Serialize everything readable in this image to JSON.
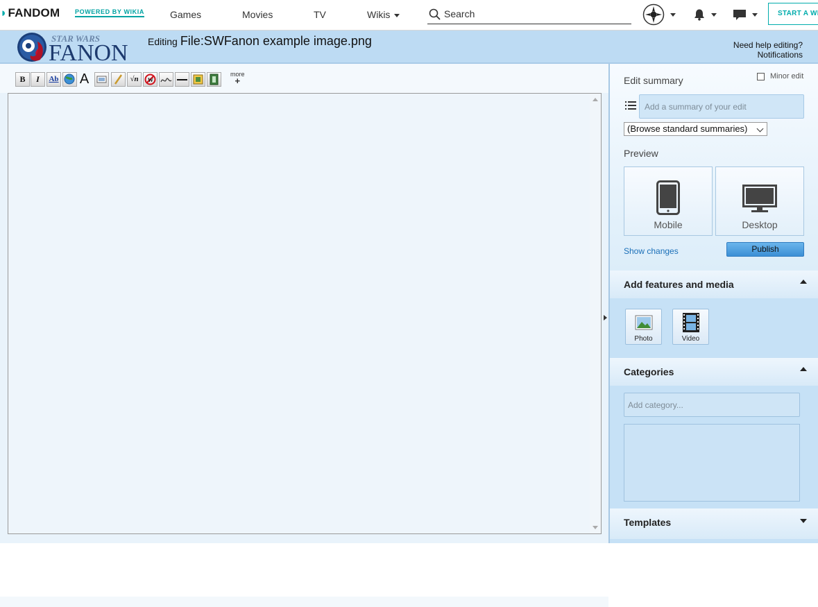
{
  "topnav": {
    "brand": "FANDOM",
    "powered_by": "POWERED BY WIKIA",
    "links": [
      "Games",
      "Movies",
      "TV",
      "Wikis"
    ],
    "search_placeholder": "Search",
    "start_wiki": "START A WIKI",
    "icons": [
      "user-avatar-icon",
      "notifications-bell-icon",
      "messages-icon"
    ]
  },
  "wiki_header": {
    "logo_text_small": "STAR WARS",
    "logo_text_big": "FANON",
    "editing_prefix": "Editing",
    "page_title": "File:SWFanon example image.png",
    "help_line1": "Need help editing?",
    "help_line2": "Notifications"
  },
  "toolbar": {
    "buttons": [
      "bold",
      "italic",
      "internal-link",
      "external-link",
      "heading",
      "embedded-file",
      "media-link",
      "math",
      "nowiki",
      "signature",
      "horizontal-line",
      "gallery",
      "video"
    ],
    "more_label": "more",
    "more_plus": "+"
  },
  "rail": {
    "edit_summary_label": "Edit summary",
    "minor_edit_label": "Minor edit",
    "summary_placeholder": "Add a summary of your edit",
    "browse_summaries": "(Browse standard summaries)",
    "preview_label": "Preview",
    "mobile_label": "Mobile",
    "desktop_label": "Desktop",
    "show_changes": "Show changes",
    "publish": "Publish",
    "features_title": "Add features and media",
    "photo_label": "Photo",
    "video_label": "Video",
    "categories_title": "Categories",
    "category_placeholder": "Add category...",
    "templates_title": "Templates"
  },
  "colors": {
    "accent_teal": "#00acac",
    "header_blue": "#bddbf3",
    "publish_blue": "#4a9ee0",
    "link_blue": "#1a6fb8"
  }
}
